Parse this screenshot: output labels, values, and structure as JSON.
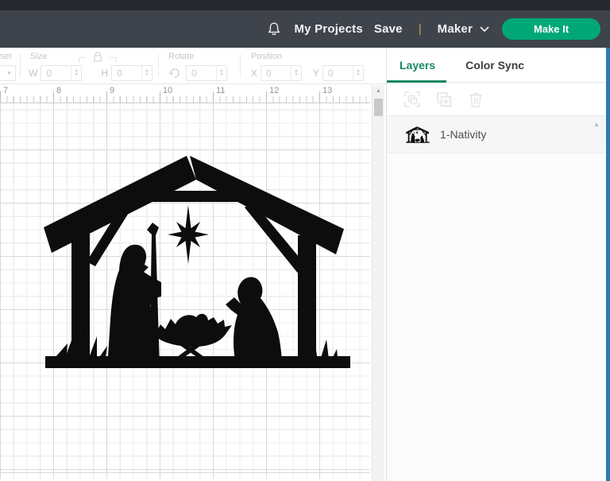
{
  "header": {
    "my_projects": "My Projects",
    "save": "Save",
    "separator": "|",
    "machine_name": "Maker",
    "make_it_label": "Make It"
  },
  "edit_toolbar": {
    "offset_label_partial": "set",
    "size_label": "Size",
    "w_label": "W",
    "w_value": "0",
    "h_label": "H",
    "h_value": "0",
    "rotate_label": "Rotate",
    "rotate_value": "0",
    "position_label": "Position",
    "x_label": "X",
    "x_value": "0",
    "y_label": "Y",
    "y_value": "0"
  },
  "ruler": {
    "labels": [
      "7",
      "8",
      "9",
      "10",
      "11",
      "12",
      "13"
    ]
  },
  "layers_panel": {
    "tab_layers": "Layers",
    "tab_color_sync": "Color Sync",
    "layer_name": "1-Nativity"
  },
  "icons": {
    "notification_bell": "bell",
    "machine_chevron": "chevron-down",
    "offset_dropdown": "▼",
    "stepper_up": "▲",
    "stepper_down": "▼",
    "scroll_up": "▲",
    "lock": "size-lock",
    "rotate": "rotate-arrow",
    "select_frame": "select-layers",
    "duplicate": "duplicate-layer",
    "delete": "trash",
    "layer_thumbnail": "nativity-silhouette"
  },
  "colors": {
    "accent_green": "#00a878",
    "active_tab_green": "#178a60",
    "header_bg": "#3f444c",
    "titlebar_bg": "#26282d",
    "window_edge_blue": "#2c7ab3",
    "separator_gold": "#c0a04c",
    "silhouette": "#0d0d0d"
  }
}
